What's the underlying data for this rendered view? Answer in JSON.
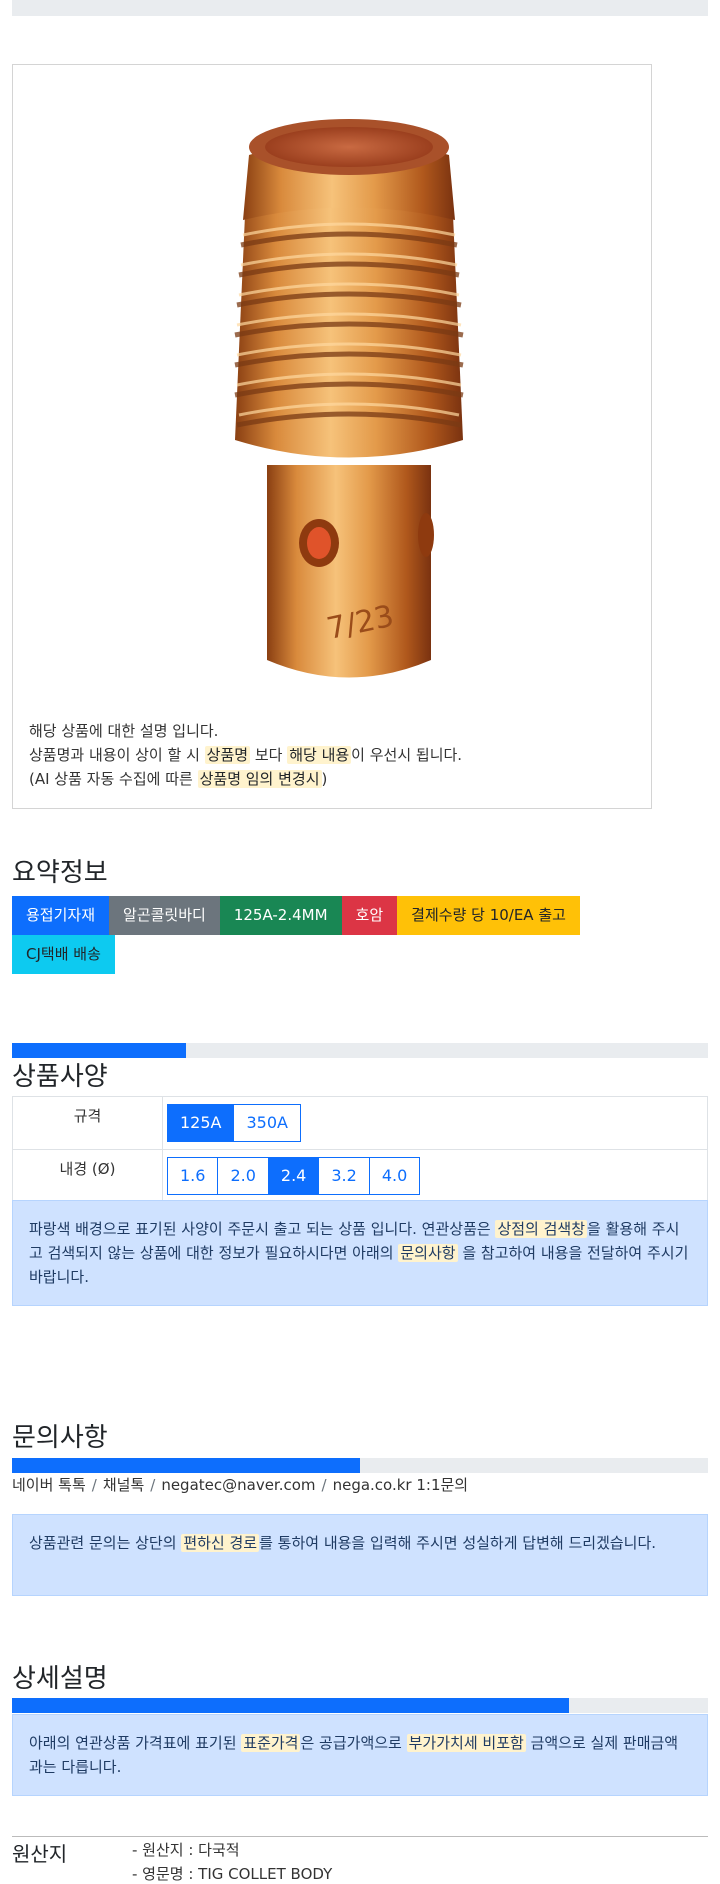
{
  "product": {
    "image_alt": "TIG collet body",
    "desc_line1": "해당 상품에 대한 설명 입니다.",
    "desc_line2_a": "상품명과 내용이 상이 할 시 ",
    "desc_line2_mark1": "상품명",
    "desc_line2_b": " 보다 ",
    "desc_line2_mark2": "해당 내용",
    "desc_line2_c": "이 우선시 됩니다.",
    "desc_line3_a": "(AI 상품 자동 수집에 따른 ",
    "desc_line3_mark": "상품명 임의 변경시",
    "desc_line3_b": ")"
  },
  "summary": {
    "title": "요약정보",
    "badges": [
      "용접기자재",
      "알곤콜릿바디",
      "125A-2.4MM",
      "호암",
      "결제수량 당 10/EA 출고",
      "CJ택배 배송"
    ]
  },
  "spec": {
    "title": "상품사양",
    "progress": 0.25,
    "rows": [
      {
        "label": "규격",
        "options": [
          "125A",
          "350A"
        ],
        "selected": "125A"
      },
      {
        "label": "내경 (Ø)",
        "options": [
          "1.6",
          "2.0",
          "2.4",
          "3.2",
          "4.0"
        ],
        "selected": "2.4"
      }
    ],
    "note_a": "파랑색 배경으로 표기된 사양이 주문시 출고 되는 상품 입니다. 연관상품은 ",
    "note_mark1": "상점의 검색창",
    "note_b": "을 활용해 주시고 검색되지 않는 상품에 대한 정보가 필요하시다면 아래의 ",
    "note_mark2": "문의사항",
    "note_c": " 을 참고하여 내용을 전달하여 주시기 바랍니다."
  },
  "inquiry": {
    "title": "문의사항",
    "progress": 0.5,
    "contacts": [
      "네이버 톡톡",
      "채널톡",
      "negatec@naver.com",
      "nega.co.kr 1:1문의"
    ],
    "note_a": "상품관련 문의는 상단의 ",
    "note_mark": "편하신 경로",
    "note_b": "를 통하여 내용을 입력해 주시면 성실하게 답변해 드리겠습니다."
  },
  "detail": {
    "title": "상세설명",
    "progress": 0.8,
    "note_a": "아래의 연관상품 가격표에 표기된 ",
    "note_mark1": "표준가격",
    "note_b": "은 공급가액으로 ",
    "note_mark2": "부가가치세 비포함",
    "note_c": " 금액으로 실제 판매금액과는 다릅니다."
  },
  "origin": {
    "title": "원산지",
    "items": [
      "- 원산지 : 다국적",
      "- 영문명 : TIG COLLET BODY"
    ]
  },
  "colors": {
    "primary": "#0d6efd",
    "secondary": "#6c757d",
    "success": "#198754",
    "danger": "#dc3545",
    "warning": "#ffc107",
    "info": "#0dcaf0",
    "alert_bg": "#cfe2ff",
    "highlight": "#fff3cd"
  }
}
